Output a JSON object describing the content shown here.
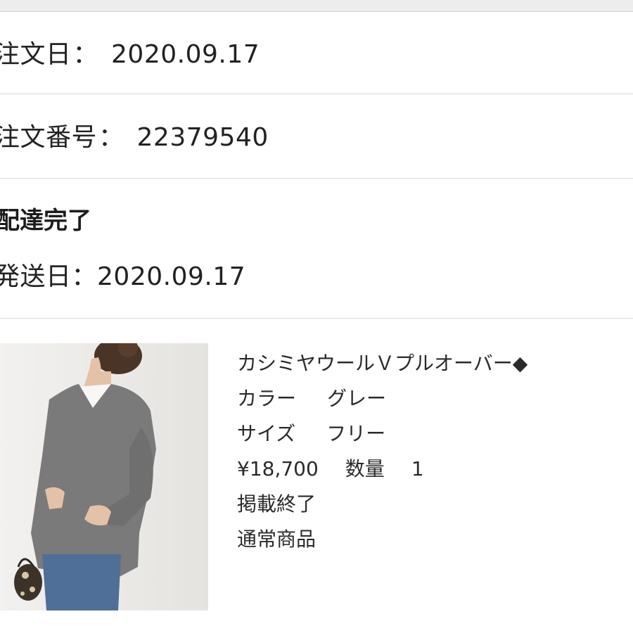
{
  "order": {
    "order_date_label": "注文日",
    "order_date": "2020.09.17",
    "order_number_label": "注文番号",
    "order_number": "22379540",
    "separator": "：",
    "status": "配達完了",
    "ship_date_label": "発送日",
    "ship_date": "2020.09.17"
  },
  "product": {
    "name": "カシミヤウールＶプルオーバー◆",
    "color_label": "カラー",
    "color_value": "グレー",
    "size_label": "サイズ",
    "size_value": "フリー",
    "price": "¥18,700",
    "quantity_label": "数量",
    "quantity_value": "1",
    "listing_status": "掲載終了",
    "item_type": "通常商品",
    "image": {
      "icon": "product-photo",
      "garment_color": "#7a7a7a",
      "background": "#ececea"
    }
  }
}
